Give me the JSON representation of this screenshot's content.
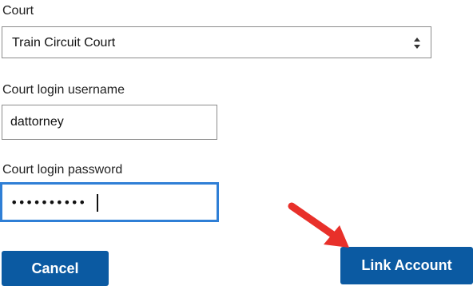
{
  "form": {
    "court_label": "Court",
    "court_selected": "Train Circuit Court",
    "username_label": "Court login username",
    "username_value": "dattorney",
    "password_label": "Court login password",
    "password_value": "••••••••••"
  },
  "buttons": {
    "cancel_label": "Cancel",
    "link_account_label": "Link Account"
  },
  "colors": {
    "button_bg": "#0b5aa2",
    "focus_border": "#2f7fd6",
    "annotation_arrow": "#e8302a"
  },
  "icons": {
    "select_arrows": "sort-updown-icon",
    "annotation": "red-arrow-icon"
  }
}
